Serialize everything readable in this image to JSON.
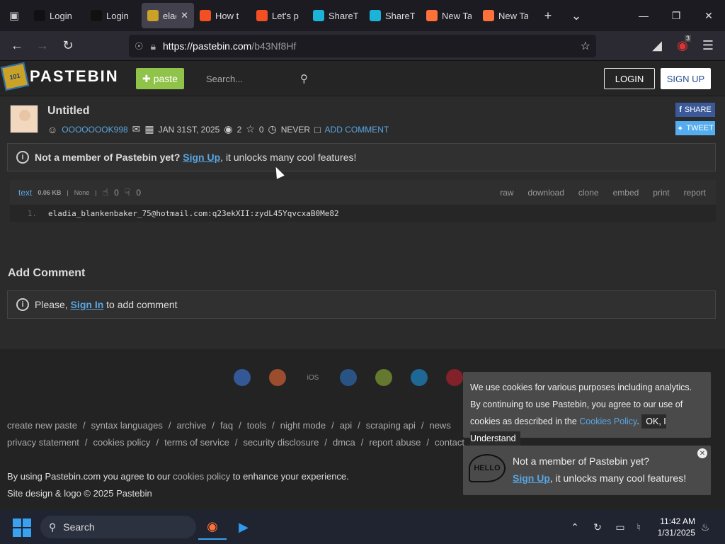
{
  "browser": {
    "tabs": [
      {
        "label": "Login",
        "icon": "github-icon",
        "color": "#111111"
      },
      {
        "label": "Login",
        "icon": "github-icon",
        "color": "#111111"
      },
      {
        "label": "elad",
        "icon": "pastebin-icon",
        "color": "#c9a227",
        "active": true
      },
      {
        "label": "How t",
        "icon": "microsoft-icon",
        "color": "#f25022"
      },
      {
        "label": "Let's p",
        "icon": "microsoft-icon",
        "color": "#f25022"
      },
      {
        "label": "ShareT",
        "icon": "sharetext-icon",
        "color": "#1bb4d8"
      },
      {
        "label": "ShareT",
        "icon": "sharetext-icon",
        "color": "#1bb4d8"
      },
      {
        "label": "New Ta",
        "icon": "firefox-icon",
        "color": "#ff7139"
      },
      {
        "label": "New Ta",
        "icon": "firefox-icon",
        "color": "#ff7139"
      }
    ],
    "url_host": "https://pastebin.com",
    "url_path": "/b43Nf8Hf",
    "extension_badge": "3"
  },
  "header": {
    "logo": "PASTEBIN",
    "paste_button": "paste",
    "search_placeholder": "Search...",
    "login": "LOGIN",
    "signup": "SIGN UP"
  },
  "paste": {
    "title": "Untitled",
    "author": "OOOOOOOK998",
    "date": "JAN 31ST, 2025",
    "views": "2",
    "stars": "0",
    "expiry": "NEVER",
    "add_comment": "ADD COMMENT",
    "share": "SHARE",
    "tweet": "TWEET"
  },
  "notice": {
    "prefix": "Not a member of Pastebin yet?",
    "link": "Sign Up",
    "suffix": ", it unlocks many cool features!"
  },
  "code": {
    "syntax": "text",
    "size": "0.06 KB",
    "category": "None",
    "likes": "0",
    "dislikes": "0",
    "actions": [
      "raw",
      "download",
      "clone",
      "embed",
      "print",
      "report"
    ],
    "lines": [
      {
        "num": "1.",
        "text": "eladia_blankenbaker_75@hotmail.com:q23ekXII:zydL45YqvcxaB0Me82"
      }
    ]
  },
  "comments": {
    "heading": "Add Comment",
    "prefix": "Please,",
    "link": "Sign In",
    "suffix": "to add comment"
  },
  "footer": {
    "apps": [
      "chrome",
      "firefox",
      "iOS",
      "windows",
      "android",
      "x",
      "opera"
    ],
    "links_row1": [
      "create new paste",
      "syntax languages",
      "archive",
      "faq",
      "tools",
      "night mode",
      "api",
      "scraping api",
      "news"
    ],
    "links_row2": [
      "privacy statement",
      "cookies policy",
      "terms of service",
      "security disclosure",
      "dmca",
      "report abuse",
      "contact"
    ],
    "agree_prefix": "By using Pastebin.com you agree to our",
    "agree_link": "cookies policy",
    "agree_suffix": "to enhance your experience.",
    "copyright": "Site design & logo © 2025 Pastebin"
  },
  "cookie_banner": {
    "text": "We use cookies for various purposes including analytics. By continuing to use Pastebin, you agree to our use of cookies as described in the",
    "link": "Cookies Policy",
    "ok": "OK, I Understand"
  },
  "member_popup": {
    "hello": "HELLO",
    "line1": "Not a member of Pastebin yet?",
    "link": "Sign Up",
    "line2_suffix": ", it unlocks many cool features!"
  },
  "taskbar": {
    "search": "Search",
    "time": "11:42 AM",
    "date": "1/31/2025"
  }
}
